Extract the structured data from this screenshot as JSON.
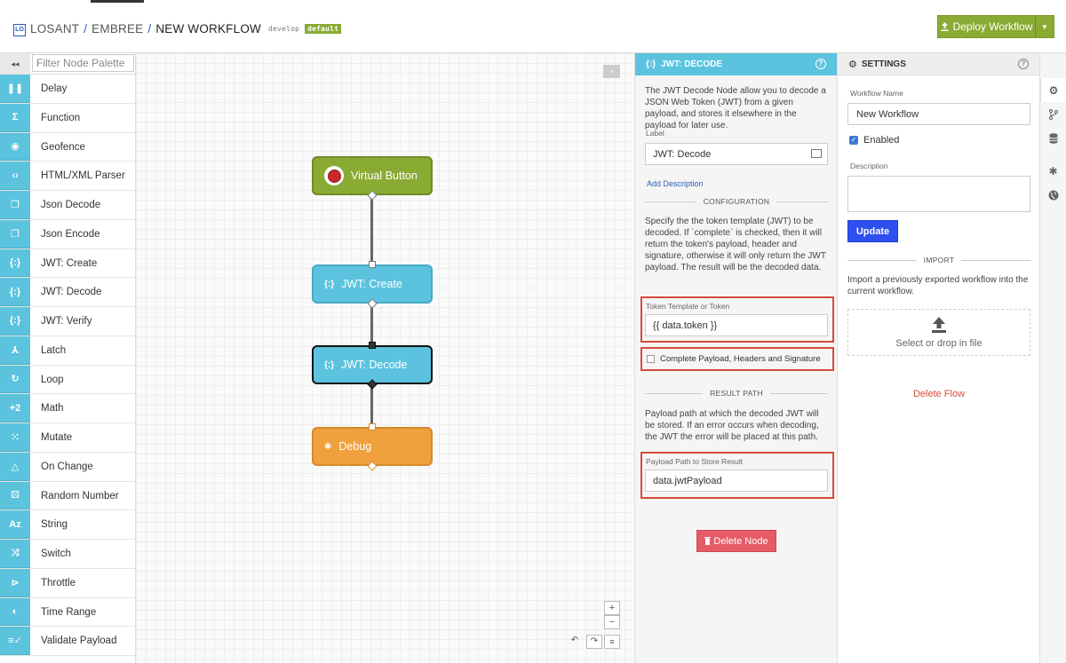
{
  "header": {
    "logo_text": "LO",
    "breadcrumb": [
      "LOSANT",
      "EMBREE",
      "NEW WORKFLOW"
    ],
    "separator": "/",
    "version": "develop",
    "version_badge": "default",
    "deploy_label": "Deploy Workflow",
    "deploy_icon": "upload-icon"
  },
  "palette": {
    "filter_placeholder": "Filter Node Palette",
    "collapse_icon": "◂◂",
    "items": [
      {
        "label": "Delay",
        "icon": "❚❚"
      },
      {
        "label": "Function",
        "icon": "Σ"
      },
      {
        "label": "Geofence",
        "icon": "◉"
      },
      {
        "label": "HTML/XML Parser",
        "icon": "‹›"
      },
      {
        "label": "Json Decode",
        "icon": "❐"
      },
      {
        "label": "Json Encode",
        "icon": "❐"
      },
      {
        "label": "JWT: Create",
        "icon": "{:}"
      },
      {
        "label": "JWT: Decode",
        "icon": "{:}"
      },
      {
        "label": "JWT: Verify",
        "icon": "{:}"
      },
      {
        "label": "Latch",
        "icon": "⅄"
      },
      {
        "label": "Loop",
        "icon": "↻"
      },
      {
        "label": "Math",
        "icon": "+2"
      },
      {
        "label": "Mutate",
        "icon": "⁙"
      },
      {
        "label": "On Change",
        "icon": "△"
      },
      {
        "label": "Random Number",
        "icon": "⚄"
      },
      {
        "label": "String",
        "icon": "Az"
      },
      {
        "label": "Switch",
        "icon": "⤨"
      },
      {
        "label": "Throttle",
        "icon": "⊳"
      },
      {
        "label": "Time Range",
        "icon": "◐"
      },
      {
        "label": "Validate Payload",
        "icon": "≡✓"
      }
    ]
  },
  "canvas": {
    "settings_icon": "▪",
    "nodes": {
      "virtual_button": {
        "label": "Virtual Button"
      },
      "jwt_create": {
        "label": "JWT: Create",
        "icon": "{:}"
      },
      "jwt_decode": {
        "label": "JWT: Decode",
        "icon": "{:}"
      },
      "debug": {
        "label": "Debug",
        "icon": "✱"
      }
    },
    "zoom_in": "+",
    "zoom_out": "−",
    "undo": "↶",
    "redo": "↷",
    "menu": "≡"
  },
  "node_panel": {
    "title": "JWT: DECODE",
    "title_icon": "{:}",
    "help": "?",
    "intro": "The JWT Decode Node allow you to decode a JSON Web Token (JWT) from a given payload, and stores it elsewhere in the payload for later use.",
    "label_caption": "Label",
    "label_value": "JWT: Decode",
    "add_description": "Add Description",
    "configuration_title": "CONFIGURATION",
    "configuration_text": "Specify the the token template (JWT) to be decoded. If `complete` is checked, then it will return the token's payload, header and signature, otherwise it will only return the JWT payload. The result will be the decoded data.",
    "token_caption": "Token Template or Token",
    "token_value": "{{ data.token }}",
    "complete_label": "Complete Payload, Headers and Signature",
    "complete_checked": false,
    "result_title": "RESULT PATH",
    "result_text": "Payload path at which the decoded JWT will be stored. If an error occurs when decoding, the JWT the error will be placed at this path.",
    "result_caption": "Payload Path to Store Result",
    "result_value": "data.jwtPayload",
    "delete_label": "Delete Node",
    "delete_icon": "trash-icon"
  },
  "settings_panel": {
    "title": "SETTINGS",
    "help": "?",
    "name_caption": "Workflow Name",
    "name_value": "New Workflow",
    "enabled_label": "Enabled",
    "enabled_checked": true,
    "description_caption": "Description",
    "description_value": "",
    "update_label": "Update",
    "import_title": "IMPORT",
    "import_text": "Import a previously exported workflow into the current workflow.",
    "drop_label": "Select or drop in file",
    "delete_flow": "Delete Flow"
  },
  "rail": {
    "items": [
      "gear-icon",
      "branch-icon",
      "database-icon",
      "bug-icon",
      "globe-icon"
    ]
  }
}
